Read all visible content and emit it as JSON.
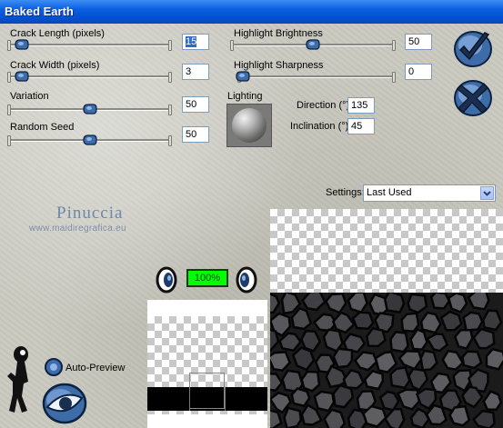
{
  "window": {
    "title": "Baked Earth"
  },
  "params": {
    "crack_length": {
      "label": "Crack Length (pixels)",
      "value": "15",
      "slider_fraction": 0.06
    },
    "crack_width": {
      "label": "Crack Width (pixels)",
      "value": "3",
      "slider_fraction": 0.06
    },
    "variation": {
      "label": "Variation",
      "value": "50",
      "slider_fraction": 0.5
    },
    "random_seed": {
      "label": "Random Seed",
      "value": "50",
      "slider_fraction": 0.5
    },
    "highlight_brightness": {
      "label": "Highlight Brightness",
      "value": "50",
      "slider_fraction": 0.5
    },
    "highlight_sharpness": {
      "label": "Highlight Sharpness",
      "value": "0",
      "slider_fraction": 0.0
    }
  },
  "lighting": {
    "label": "Lighting",
    "direction_label": "Direction (°)",
    "direction_value": "135",
    "inclination_label": "Inclination (°)",
    "inclination_value": "45"
  },
  "settings": {
    "label": "Settings:",
    "selected": "Last Used"
  },
  "watermark": {
    "line1": "Pinuccia",
    "line2": "www.maidiregrafica.eu"
  },
  "preview": {
    "zoom": "100%",
    "auto_preview_label": "Auto-Preview"
  },
  "colors": {
    "title_bar": "#0352d6",
    "zoom_box": "#00ff00",
    "button_blue": "#4a7fc0"
  },
  "icons": [
    "ok-check-icon",
    "cancel-x-icon",
    "zoom-in-eye-icon",
    "zoom-out-eye-icon",
    "help-figure-icon",
    "preview-eye-icon",
    "auto-preview-radio-icon"
  ]
}
